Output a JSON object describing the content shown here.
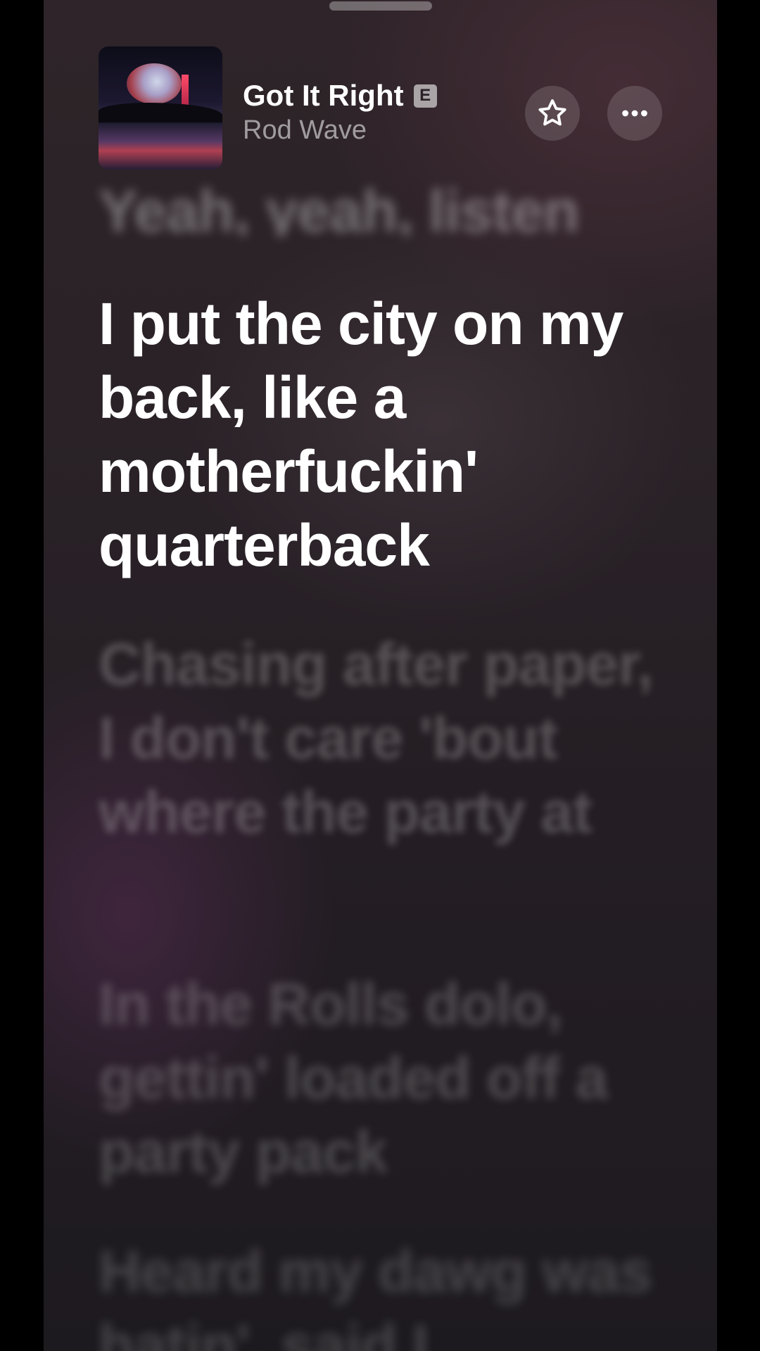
{
  "header": {
    "song_title": "Got It Right",
    "explicit_badge": "E",
    "artist": "Rod Wave",
    "favorite_icon": "star-icon",
    "more_icon": "ellipsis-icon"
  },
  "lyrics": {
    "previous": "Yeah, yeah, listen",
    "current": "I put the city on my back, like a motherfuckin' quarterback",
    "next_1": "Chasing after paper, I don't care 'bout where the party at",
    "next_2": "In the Rolls dolo, gettin' loaded off a party pack",
    "next_3": "Heard my dawg was hatin', said I"
  },
  "colors": {
    "lyric_active": "#ffffff",
    "background": "#2a2227"
  }
}
